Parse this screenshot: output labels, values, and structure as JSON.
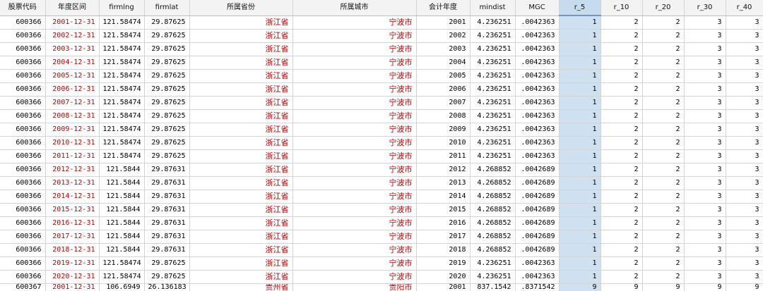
{
  "columns": [
    "股票代码",
    "年度区间",
    "firmlng",
    "firmlat",
    "所属省份",
    "所属城市",
    "会计年度",
    "mindist",
    "MGC",
    "r_5",
    "r_10",
    "r_20",
    "r_30",
    "r_40"
  ],
  "rows": [
    [
      "600366",
      "2001-12-31",
      "121.58474",
      "29.87625",
      "浙江省",
      "宁波市",
      "2001",
      "4.236251",
      ".0042363",
      "1",
      "2",
      "2",
      "3",
      "3"
    ],
    [
      "600366",
      "2002-12-31",
      "121.58474",
      "29.87625",
      "浙江省",
      "宁波市",
      "2002",
      "4.236251",
      ".0042363",
      "1",
      "2",
      "2",
      "3",
      "3"
    ],
    [
      "600366",
      "2003-12-31",
      "121.58474",
      "29.87625",
      "浙江省",
      "宁波市",
      "2003",
      "4.236251",
      ".0042363",
      "1",
      "2",
      "2",
      "3",
      "3"
    ],
    [
      "600366",
      "2004-12-31",
      "121.58474",
      "29.87625",
      "浙江省",
      "宁波市",
      "2004",
      "4.236251",
      ".0042363",
      "1",
      "2",
      "2",
      "3",
      "3"
    ],
    [
      "600366",
      "2005-12-31",
      "121.58474",
      "29.87625",
      "浙江省",
      "宁波市",
      "2005",
      "4.236251",
      ".0042363",
      "1",
      "2",
      "2",
      "3",
      "3"
    ],
    [
      "600366",
      "2006-12-31",
      "121.58474",
      "29.87625",
      "浙江省",
      "宁波市",
      "2006",
      "4.236251",
      ".0042363",
      "1",
      "2",
      "2",
      "3",
      "3"
    ],
    [
      "600366",
      "2007-12-31",
      "121.58474",
      "29.87625",
      "浙江省",
      "宁波市",
      "2007",
      "4.236251",
      ".0042363",
      "1",
      "2",
      "2",
      "3",
      "3"
    ],
    [
      "600366",
      "2008-12-31",
      "121.58474",
      "29.87625",
      "浙江省",
      "宁波市",
      "2008",
      "4.236251",
      ".0042363",
      "1",
      "2",
      "2",
      "3",
      "3"
    ],
    [
      "600366",
      "2009-12-31",
      "121.58474",
      "29.87625",
      "浙江省",
      "宁波市",
      "2009",
      "4.236251",
      ".0042363",
      "1",
      "2",
      "2",
      "3",
      "3"
    ],
    [
      "600366",
      "2010-12-31",
      "121.58474",
      "29.87625",
      "浙江省",
      "宁波市",
      "2010",
      "4.236251",
      ".0042363",
      "1",
      "2",
      "2",
      "3",
      "3"
    ],
    [
      "600366",
      "2011-12-31",
      "121.58474",
      "29.87625",
      "浙江省",
      "宁波市",
      "2011",
      "4.236251",
      ".0042363",
      "1",
      "2",
      "2",
      "3",
      "3"
    ],
    [
      "600366",
      "2012-12-31",
      "121.5844",
      "29.87631",
      "浙江省",
      "宁波市",
      "2012",
      "4.268852",
      ".0042689",
      "1",
      "2",
      "2",
      "3",
      "3"
    ],
    [
      "600366",
      "2013-12-31",
      "121.5844",
      "29.87631",
      "浙江省",
      "宁波市",
      "2013",
      "4.268852",
      ".0042689",
      "1",
      "2",
      "2",
      "3",
      "3"
    ],
    [
      "600366",
      "2014-12-31",
      "121.5844",
      "29.87631",
      "浙江省",
      "宁波市",
      "2014",
      "4.268852",
      ".0042689",
      "1",
      "2",
      "2",
      "3",
      "3"
    ],
    [
      "600366",
      "2015-12-31",
      "121.5844",
      "29.87631",
      "浙江省",
      "宁波市",
      "2015",
      "4.268852",
      ".0042689",
      "1",
      "2",
      "2",
      "3",
      "3"
    ],
    [
      "600366",
      "2016-12-31",
      "121.5844",
      "29.87631",
      "浙江省",
      "宁波市",
      "2016",
      "4.268852",
      ".0042689",
      "1",
      "2",
      "2",
      "3",
      "3"
    ],
    [
      "600366",
      "2017-12-31",
      "121.5844",
      "29.87631",
      "浙江省",
      "宁波市",
      "2017",
      "4.268852",
      ".0042689",
      "1",
      "2",
      "2",
      "3",
      "3"
    ],
    [
      "600366",
      "2018-12-31",
      "121.5844",
      "29.87631",
      "浙江省",
      "宁波市",
      "2018",
      "4.268852",
      ".0042689",
      "1",
      "2",
      "2",
      "3",
      "3"
    ],
    [
      "600366",
      "2019-12-31",
      "121.58474",
      "29.87625",
      "浙江省",
      "宁波市",
      "2019",
      "4.236251",
      ".0042363",
      "1",
      "2",
      "2",
      "3",
      "3"
    ],
    [
      "600366",
      "2020-12-31",
      "121.58474",
      "29.87625",
      "浙江省",
      "宁波市",
      "2020",
      "4.236251",
      ".0042363",
      "1",
      "2",
      "2",
      "3",
      "3"
    ],
    [
      "600367",
      "2001-12-31",
      "106.6949",
      "26.136183",
      "贵州省",
      "贵阳市",
      "2001",
      "837.1542",
      ".8371542",
      "9",
      "9",
      "9",
      "9",
      "9"
    ]
  ],
  "selected_column": "r_5",
  "colors": {
    "red_text": "#c00000",
    "selected_bg": "#cfe0f1",
    "header_bg": "#f3f3f3"
  }
}
